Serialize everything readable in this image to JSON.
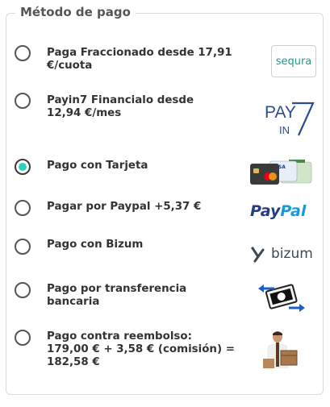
{
  "fieldset": {
    "legend": "Método de pago"
  },
  "options": [
    {
      "label_line1": "Paga Fraccionado desde 17,91",
      "label_line2": "€/cuota",
      "checked": false,
      "logo": "sequra-logo",
      "logo_text": "sequra"
    },
    {
      "label_line1": "Payin7 Financialo desde",
      "label_line2": "12,94 €/mes",
      "checked": false,
      "logo": "payin7-logo"
    },
    {
      "label_line1": "Pago con Tarjeta",
      "checked": true,
      "logo": "credit-cards-logo"
    },
    {
      "label_line1": "Pagar por Paypal +5,37 €",
      "checked": false,
      "logo": "paypal-logo",
      "logo_text_a": "Pay",
      "logo_text_b": "Pal"
    },
    {
      "label_line1": "Pago con Bizum",
      "checked": false,
      "logo": "bizum-logo",
      "logo_text": "bizum"
    },
    {
      "label_line1": "Pago por transferencia",
      "label_line2": "bancaria",
      "checked": false,
      "logo": "bank-transfer-icon"
    },
    {
      "label_line1": "Pago contra reembolso:",
      "label_line2": "179,00 € + 3,58 € (comisión) =",
      "label_line3": "182,58 €",
      "checked": false,
      "logo": "cash-on-delivery-image"
    }
  ],
  "colors": {
    "radio_selected": "#2bd3bd",
    "paypal_dark": "#253b80",
    "paypal_light": "#179bd7",
    "sequra": "#1f9e8c"
  }
}
